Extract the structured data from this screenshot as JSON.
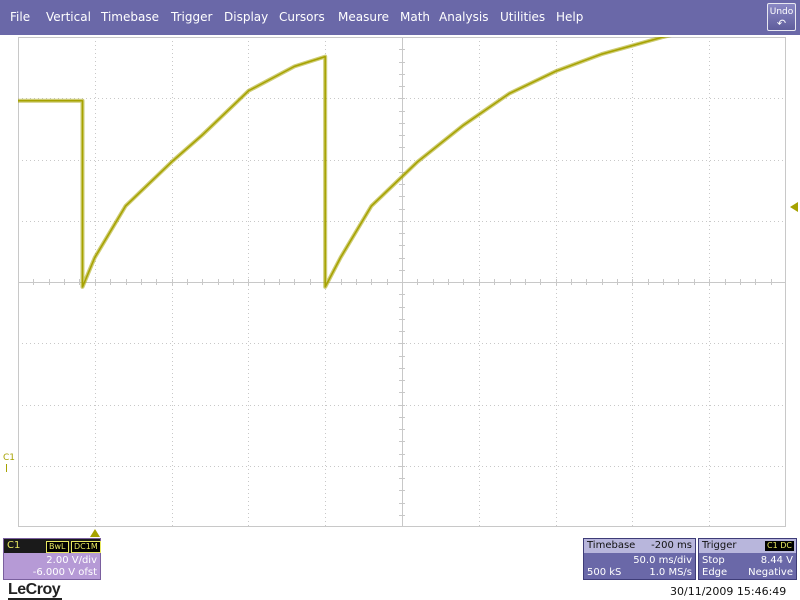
{
  "menu": {
    "items": [
      "File",
      "Vertical",
      "Timebase",
      "Trigger",
      "Display",
      "Cursors",
      "Measure",
      "Math",
      "Analysis",
      "Utilities",
      "Help"
    ],
    "undo_label": "Undo",
    "undo_icon": "undo-arrow-icon"
  },
  "channel": {
    "name": "C1",
    "side_label": "C1",
    "bwl_badge": "BwL",
    "coupling_badge": "DC1M",
    "volts_per_div": "2.00 V/div",
    "offset": "-6.000 V ofst"
  },
  "timebase": {
    "title": "Timebase",
    "delay": "-200 ms",
    "time_per_div": "50.0 ms/div",
    "samples": "500 kS",
    "sample_rate": "1.0 MS/s"
  },
  "trigger": {
    "title": "Trigger",
    "source_badge": "C1 DC",
    "mode": "Stop",
    "level": "8.44 V",
    "type": "Edge",
    "slope": "Negative"
  },
  "brand": "LeCroy",
  "timestamp": "30/11/2009 15:46:49",
  "colors": {
    "menubar": "#6a68a8",
    "trace": "#a6a200",
    "grid": "#c8c8c8",
    "channel_panel": "#b69ad6"
  },
  "chart_data": {
    "type": "line",
    "x_unit": "ms",
    "y_unit": "V",
    "xlim": [
      -200,
      300
    ],
    "ylim": [
      -14,
      6
    ],
    "grid": true,
    "grid_divisions": {
      "x": 10,
      "y": 8
    },
    "series": [
      {
        "x": [
          -200,
          -158,
          -158,
          -150,
          -130,
          -100,
          -80,
          -50,
          -20,
          0,
          0,
          10,
          30,
          60,
          90,
          120,
          150,
          180,
          220,
          260,
          300
        ],
        "y": [
          3.4,
          3.4,
          -4.2,
          -3.0,
          -0.9,
          0.9,
          2.0,
          3.8,
          4.8,
          5.2,
          -4.2,
          -3.0,
          -0.9,
          0.9,
          2.4,
          3.7,
          4.6,
          5.3,
          6.0,
          6.6,
          7.0
        ]
      }
    ]
  }
}
